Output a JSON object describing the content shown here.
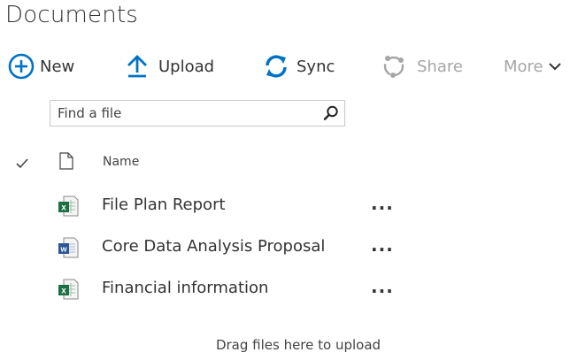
{
  "page": {
    "title": "Documents"
  },
  "toolbar": {
    "new_label": "New",
    "upload_label": "Upload",
    "sync_label": "Sync",
    "share_label": "Share",
    "more_label": "More"
  },
  "search": {
    "placeholder": "Find a file"
  },
  "list": {
    "column_name": "Name",
    "files": [
      {
        "name": "File Plan Report",
        "type": "excel",
        "icon": "excel-file-icon"
      },
      {
        "name": "Core Data Analysis Proposal",
        "type": "word",
        "icon": "word-file-icon"
      },
      {
        "name": "Financial information",
        "type": "excel",
        "icon": "excel-file-icon"
      }
    ],
    "row_menu_label": "...",
    "drop_hint": "Drag files here to upload"
  },
  "colors": {
    "accent": "#0072c6",
    "excel": "#1d7044",
    "word": "#2b5797",
    "disabled": "#a6a6a6"
  }
}
